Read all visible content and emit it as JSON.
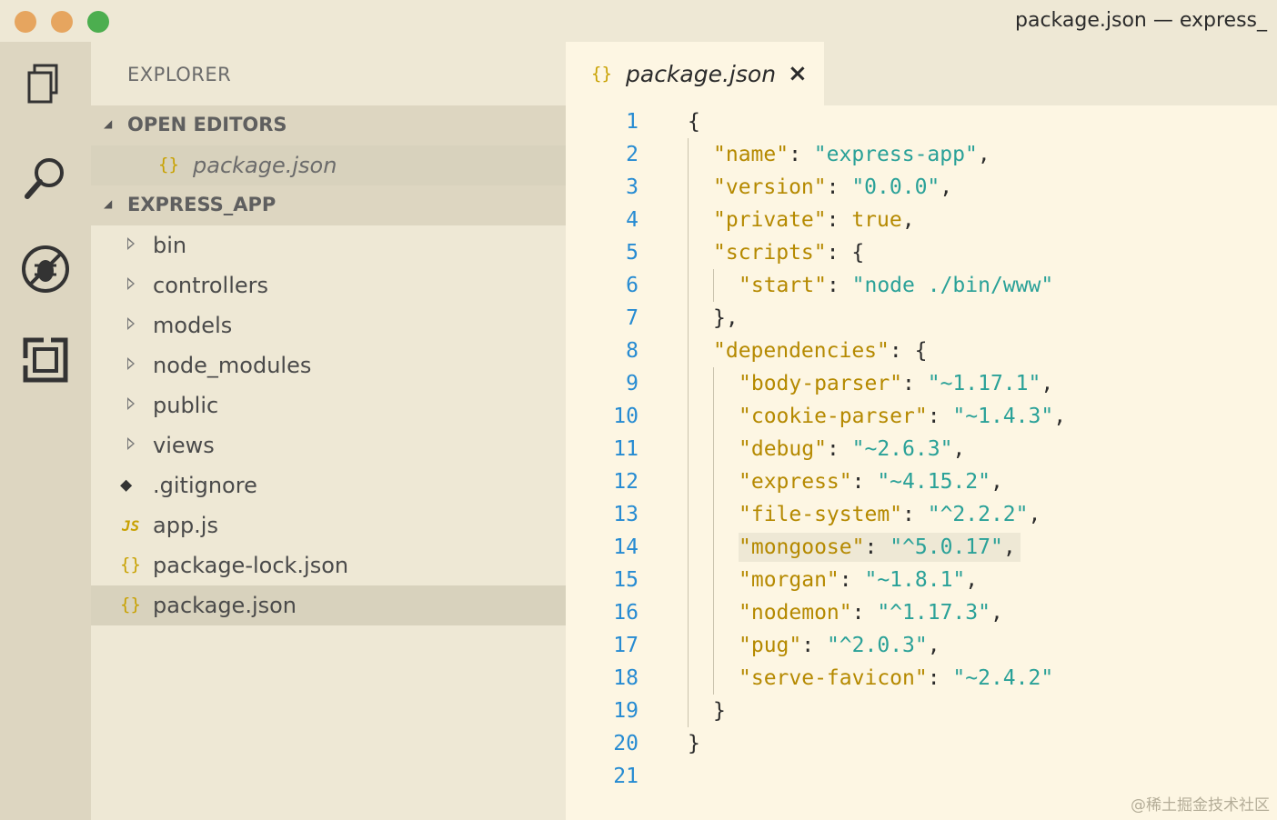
{
  "window": {
    "title": "package.json — express_"
  },
  "activity_bar": {
    "icons": [
      "files-icon",
      "search-icon",
      "debug-icon",
      "extensions-icon"
    ]
  },
  "sidebar": {
    "title": "EXPLORER",
    "open_editors": {
      "header": "OPEN EDITORS",
      "items": [
        {
          "icon": "{}",
          "label": "package.json"
        }
      ]
    },
    "project": {
      "header": "EXPRESS_APP",
      "folders": [
        "bin",
        "controllers",
        "models",
        "node_modules",
        "public",
        "views"
      ],
      "files": [
        {
          "icon": "git",
          "label": ".gitignore"
        },
        {
          "icon": "JS",
          "label": "app.js"
        },
        {
          "icon": "{}",
          "label": "package-lock.json"
        },
        {
          "icon": "{}",
          "label": "package.json",
          "selected": true
        }
      ]
    }
  },
  "editor": {
    "tab": {
      "icon": "{}",
      "label": "package.json",
      "close": "×"
    },
    "line_numbers": [
      "1",
      "2",
      "3",
      "4",
      "5",
      "6",
      "7",
      "8",
      "9",
      "10",
      "11",
      "12",
      "13",
      "14",
      "15",
      "16",
      "17",
      "18",
      "19",
      "20",
      "21"
    ],
    "lines": [
      {
        "indent": 0,
        "key": "",
        "value": "",
        "text": "{"
      },
      {
        "indent": 1,
        "key": "\"name\"",
        "sep": ": ",
        "value": "\"express-app\"",
        "tail": ","
      },
      {
        "indent": 1,
        "key": "\"version\"",
        "sep": ": ",
        "value": "\"0.0.0\"",
        "tail": ","
      },
      {
        "indent": 1,
        "key": "\"private\"",
        "sep": ": ",
        "value": "true",
        "tail": ","
      },
      {
        "indent": 1,
        "key": "\"scripts\"",
        "sep": ": ",
        "value": "",
        "tail": "{"
      },
      {
        "indent": 2,
        "key": "\"start\"",
        "sep": ": ",
        "value": "\"node ./bin/www\"",
        "tail": ""
      },
      {
        "indent": 1,
        "key": "",
        "value": "",
        "text": "},"
      },
      {
        "indent": 1,
        "key": "\"dependencies\"",
        "sep": ": ",
        "value": "",
        "tail": "{"
      },
      {
        "indent": 2,
        "key": "\"body-parser\"",
        "sep": ": ",
        "value": "\"~1.17.1\"",
        "tail": ","
      },
      {
        "indent": 2,
        "key": "\"cookie-parser\"",
        "sep": ": ",
        "value": "\"~1.4.3\"",
        "tail": ","
      },
      {
        "indent": 2,
        "key": "\"debug\"",
        "sep": ": ",
        "value": "\"~2.6.3\"",
        "tail": ","
      },
      {
        "indent": 2,
        "key": "\"express\"",
        "sep": ": ",
        "value": "\"~4.15.2\"",
        "tail": ","
      },
      {
        "indent": 2,
        "key": "\"file-system\"",
        "sep": ": ",
        "value": "\"^2.2.2\"",
        "tail": ","
      },
      {
        "indent": 2,
        "key": "\"mongoose\"",
        "sep": ": ",
        "value": "\"^5.0.17\"",
        "tail": ",",
        "highlight": true
      },
      {
        "indent": 2,
        "key": "\"morgan\"",
        "sep": ": ",
        "value": "\"~1.8.1\"",
        "tail": ","
      },
      {
        "indent": 2,
        "key": "\"nodemon\"",
        "sep": ": ",
        "value": "\"^1.17.3\"",
        "tail": ","
      },
      {
        "indent": 2,
        "key": "\"pug\"",
        "sep": ": ",
        "value": "\"^2.0.3\"",
        "tail": ","
      },
      {
        "indent": 2,
        "key": "\"serve-favicon\"",
        "sep": ": ",
        "value": "\"~2.4.2\"",
        "tail": ""
      },
      {
        "indent": 1,
        "key": "",
        "value": "",
        "text": "}"
      },
      {
        "indent": 0,
        "key": "",
        "value": "",
        "text": "}"
      },
      {
        "indent": 0,
        "key": "",
        "value": "",
        "text": ""
      }
    ]
  },
  "colors": {
    "key": "#b58900",
    "string": "#2aa198",
    "line_number": "#268bd2",
    "background": "#fdf6e3",
    "sidebar": "#eee8d5"
  },
  "watermark": "@稀土掘金技术社区"
}
